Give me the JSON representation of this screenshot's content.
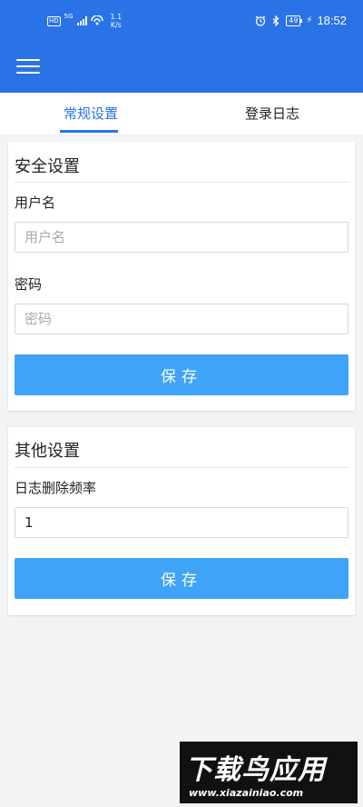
{
  "status_bar": {
    "hd": "HD",
    "signal_5g": "5G",
    "speed_value": "1.1",
    "speed_unit": "K/s",
    "battery": "49",
    "time": "18:52"
  },
  "app_bar": {
    "menu_icon": "hamburger-menu-icon"
  },
  "tabs": [
    {
      "label": "常规设置",
      "active": true
    },
    {
      "label": "登录日志",
      "active": false
    }
  ],
  "security_section": {
    "title": "安全设置",
    "username_label": "用户名",
    "username_placeholder": "用户名",
    "username_value": "",
    "password_label": "密码",
    "password_placeholder": "密码",
    "password_value": "",
    "save_label": "保存"
  },
  "other_section": {
    "title": "其他设置",
    "log_delete_label": "日志删除频率",
    "log_delete_value": "1",
    "save_label": "保存"
  },
  "watermark": {
    "title": "下载鸟应用",
    "url": "www.xiazainiao.com"
  },
  "colors": {
    "accent": "#2a73e6",
    "button": "#3fa4f7",
    "background": "#f2f3f5"
  }
}
